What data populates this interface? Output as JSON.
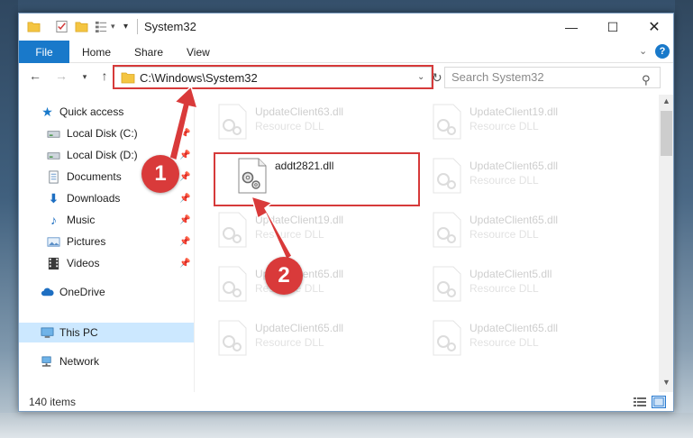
{
  "window": {
    "title": "System32",
    "minimize_glyph": "—",
    "maximize_glyph": "☐",
    "close_glyph": "✕"
  },
  "ribbon": {
    "file": "File",
    "home": "Home",
    "share": "Share",
    "view": "View",
    "help_glyph": "?"
  },
  "address": {
    "path": "C:\\Windows\\System32"
  },
  "search": {
    "placeholder": "Search System32"
  },
  "nav": {
    "quick_access": "Quick access",
    "items": [
      {
        "label": "Local Disk (C:)",
        "icon": "drive-icon"
      },
      {
        "label": "Local Disk (D:)",
        "icon": "drive-icon"
      },
      {
        "label": "Documents",
        "icon": "documents-icon"
      },
      {
        "label": "Downloads",
        "icon": "downloads-icon"
      },
      {
        "label": "Music",
        "icon": "music-icon"
      },
      {
        "label": "Pictures",
        "icon": "pictures-icon"
      },
      {
        "label": "Videos",
        "icon": "videos-icon"
      }
    ],
    "onedrive": "OneDrive",
    "this_pc": "This PC",
    "network": "Network"
  },
  "files": [
    {
      "name": "UpdateClient63.dll",
      "type": "Resource DLL"
    },
    {
      "name": "UpdateClient19.dll",
      "type": "Resource DLL"
    },
    {
      "name": "addt2821.dll",
      "type": ""
    },
    {
      "name": "UpdateClient65.dll",
      "type": "Resource DLL"
    },
    {
      "name": "UpdateClient19.dll",
      "type": "Resource DLL"
    },
    {
      "name": "UpdateClient65.dll",
      "type": "Resource DLL"
    },
    {
      "name": "UpdateClient65.dll",
      "type": "Resource DLL"
    },
    {
      "name": "UpdateClient5.dll",
      "type": "Resource DLL"
    },
    {
      "name": "UpdateClient65.dll",
      "type": "Resource DLL"
    },
    {
      "name": "UpdateClient65.dll",
      "type": "Resource DLL"
    }
  ],
  "status": {
    "item_count": "140 items"
  },
  "annotations": {
    "step1": "1",
    "step2": "2"
  },
  "colors": {
    "accent": "#1979ca",
    "highlight_red": "#d63a3a",
    "badge_red": "#d93a3a",
    "selected_nav": "#cce8ff"
  }
}
